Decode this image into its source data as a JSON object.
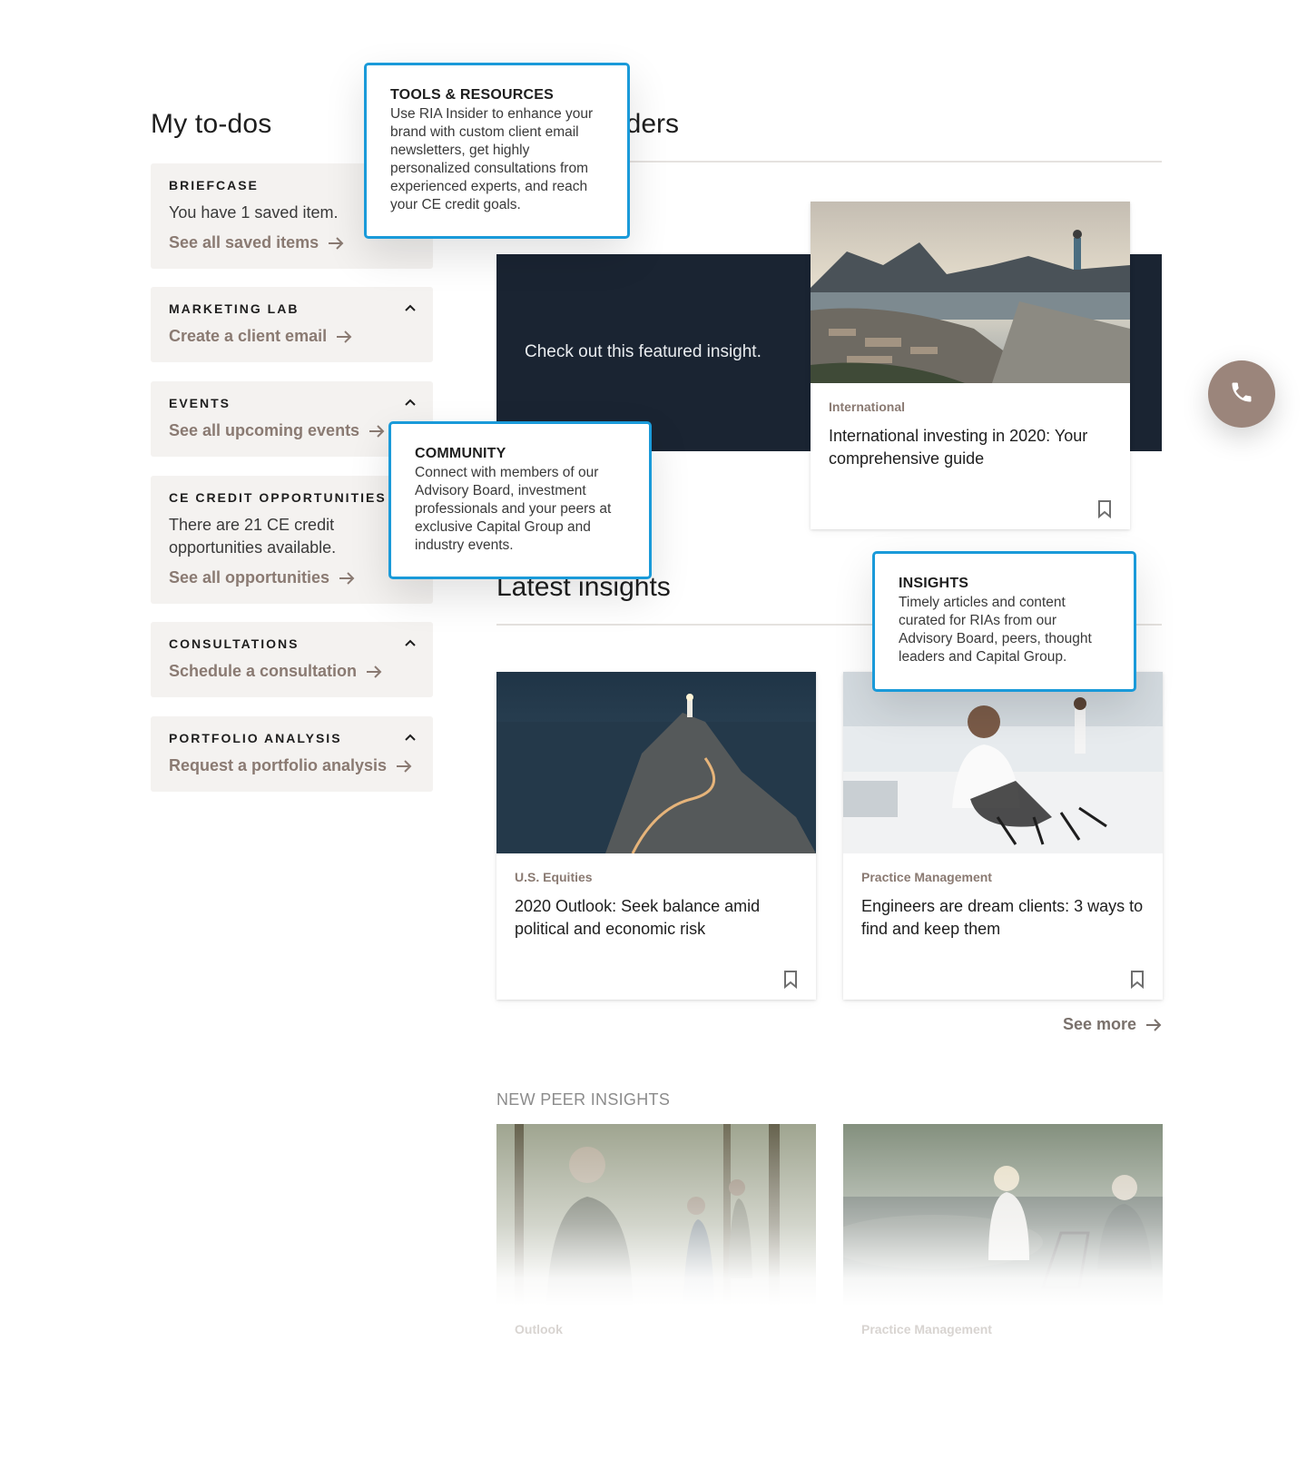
{
  "todos": {
    "title": "My to-dos",
    "cards": [
      {
        "eyebrow": "BRIEFCASE",
        "text": "You have 1 saved item.",
        "link": "See all saved items"
      },
      {
        "eyebrow": "MARKETING LAB",
        "link": "Create a client email"
      },
      {
        "eyebrow": "EVENTS",
        "link": "See all upcoming events"
      },
      {
        "eyebrow": "CE CREDIT OPPORTUNITIES",
        "text": "There are 21 CE credit opportunities available.",
        "link": "See all opportunities"
      },
      {
        "eyebrow": "CONSULTATIONS",
        "link": "Schedule a consultation"
      },
      {
        "eyebrow": "PORTFOLIO ANALYSIS",
        "link": "Request a portfolio analysis"
      }
    ]
  },
  "featured": {
    "title_fragment": "iders",
    "band_text": "Check out this featured insight.",
    "card": {
      "category": "International",
      "title": "International investing in 2020: Your comprehensive guide"
    }
  },
  "latest": {
    "title": "Latest insights",
    "cards": [
      {
        "category": "U.S. Equities",
        "title": "2020 Outlook: Seek balance amid political and economic risk"
      },
      {
        "category": "Practice Management",
        "title": "Engineers are dream clients: 3 ways to find and keep them"
      }
    ],
    "see_more": "See more"
  },
  "peer": {
    "heading": "NEW PEER INSIGHTS",
    "cards": [
      {
        "category": "Outlook"
      },
      {
        "category": "Practice Management"
      }
    ]
  },
  "callouts": {
    "tools": {
      "title": "TOOLS & RESOURCES",
      "body": "Use RIA Insider to enhance your brand with custom client email newsletters, get highly personalized consultations from experienced experts, and reach your CE credit goals."
    },
    "community": {
      "title": "COMMUNITY",
      "body": "Connect with members of our Advisory Board, investment professionals and your peers at exclusive Capital Group and industry events."
    },
    "insights": {
      "title": "INSIGHTS",
      "body": "Timely articles and content curated for RIAs from our Advisory Board, peers, thought leaders and Capital Group."
    }
  },
  "icons": {
    "arrow": "arrow-right-icon",
    "chevron": "chevron-up-icon",
    "bookmark": "bookmark-icon",
    "phone": "phone-icon"
  },
  "colors": {
    "accent_link": "#8a7a72",
    "callout_border": "#1a9ad9",
    "featured_band": "#1a2432",
    "card_bg": "#f4f2f0",
    "phone_fab": "#9b857b"
  }
}
